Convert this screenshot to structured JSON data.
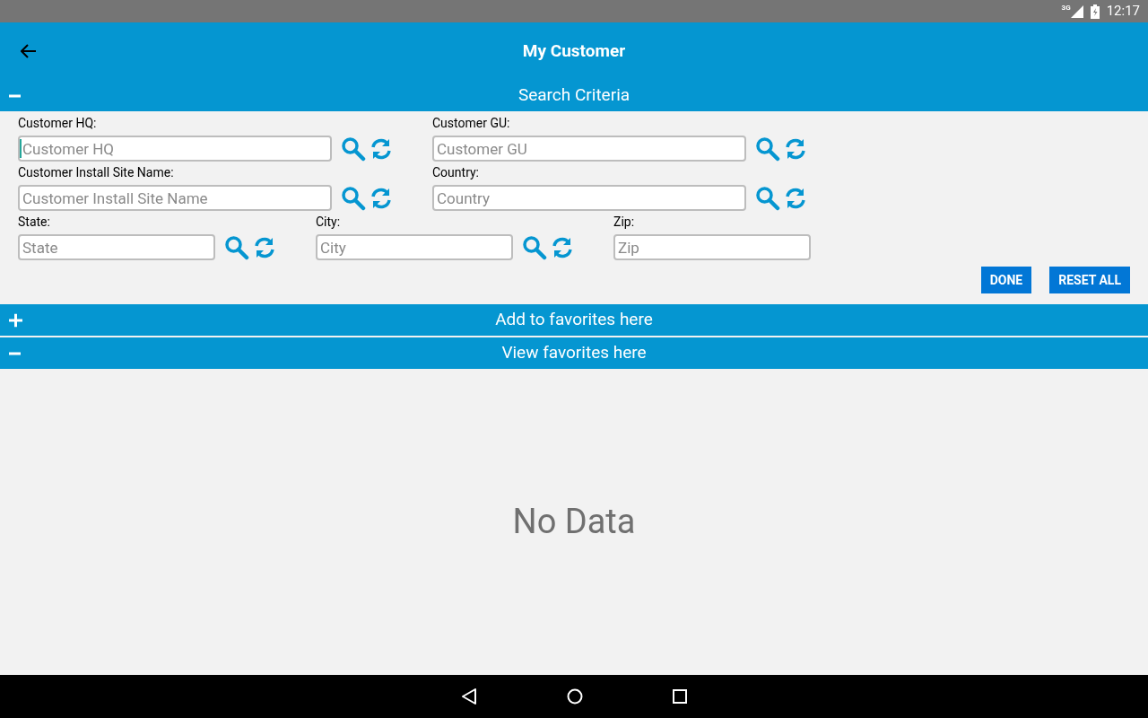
{
  "status_bar": {
    "network": "3G",
    "time": "12:17"
  },
  "app_bar": {
    "title": "My Customer"
  },
  "search_section": {
    "title": "Search Criteria",
    "expanded": true,
    "rows": [
      {
        "fields": [
          {
            "label": "Customer HQ:",
            "placeholder": "Customer HQ",
            "focused": true,
            "lookup": true
          },
          {
            "label": "Customer GU:",
            "placeholder": "Customer GU",
            "focused": false,
            "lookup": true
          }
        ]
      },
      {
        "fields": [
          {
            "label": "Customer Install Site Name:",
            "placeholder": "Customer Install Site Name",
            "focused": false,
            "lookup": true
          },
          {
            "label": "Country:",
            "placeholder": "Country",
            "focused": false,
            "lookup": true
          }
        ]
      },
      {
        "fields": [
          {
            "label": "State:",
            "placeholder": "State",
            "focused": false,
            "lookup": true
          },
          {
            "label": "City:",
            "placeholder": "City",
            "focused": false,
            "lookup": true
          },
          {
            "label": "Zip:",
            "placeholder": "Zip",
            "focused": false,
            "lookup": false
          }
        ]
      }
    ],
    "buttons": [
      "DONE",
      "RESET ALL"
    ]
  },
  "add_favorites_section": {
    "title": "Add to favorites here",
    "expanded": false
  },
  "view_favorites_section": {
    "title": "View favorites here",
    "expanded": true,
    "empty_message": "No Data"
  }
}
